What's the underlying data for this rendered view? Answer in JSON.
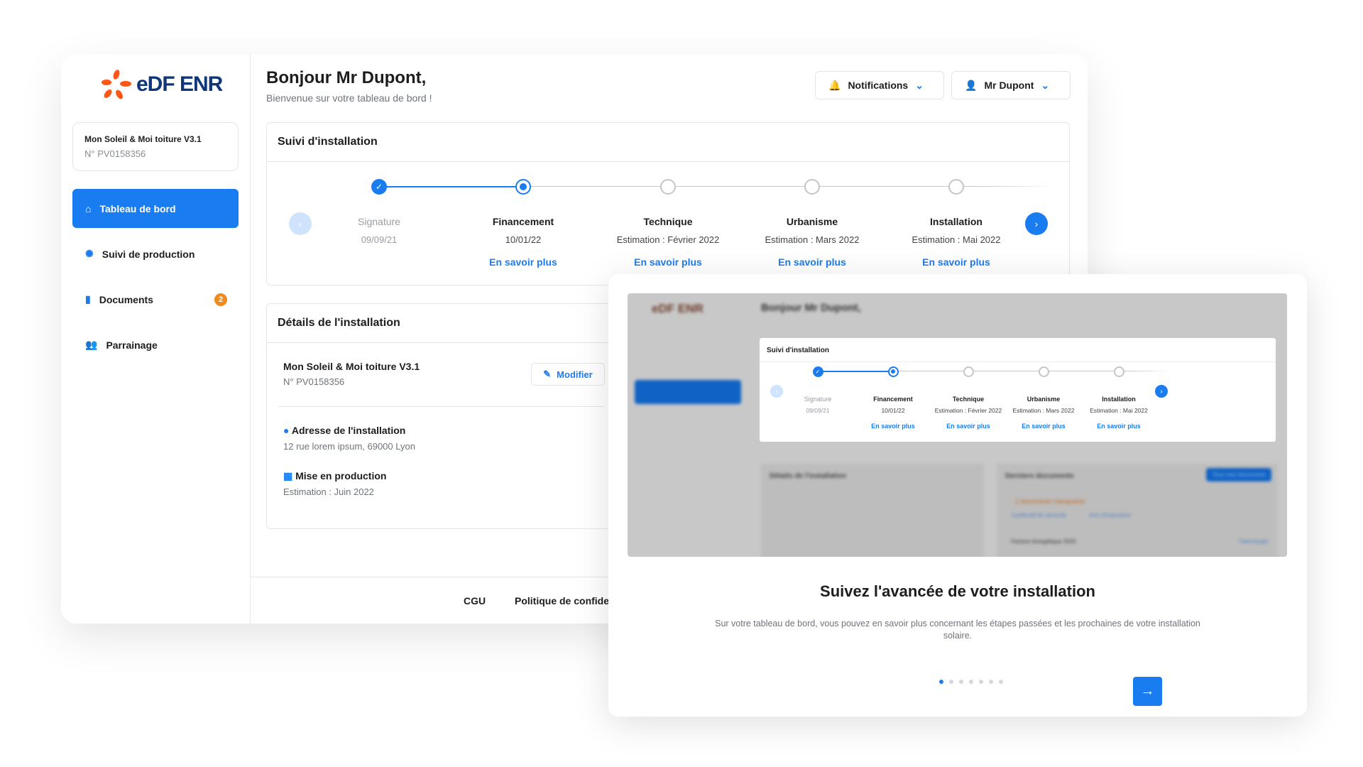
{
  "brand": {
    "name": "eDF ENR",
    "orange": "#fe5716",
    "navy": "#10367a"
  },
  "accent": "#1a7cf1",
  "project": {
    "title": "Mon Soleil & Moi toiture V3.1",
    "number": "N° PV0158356"
  },
  "sidebar": {
    "items": [
      {
        "label": "Tableau de bord",
        "icon": "home-icon",
        "active": true
      },
      {
        "label": "Suivi de production",
        "icon": "sun-icon"
      },
      {
        "label": "Documents",
        "icon": "document-icon",
        "badge": "2"
      },
      {
        "label": "Parrainage",
        "icon": "users-icon"
      }
    ]
  },
  "header": {
    "greeting": "Bonjour Mr Dupont,",
    "subtitle": "Bienvenue sur votre tableau de bord !",
    "notifications": "Notifications",
    "user": "Mr Dupont"
  },
  "tracking": {
    "title": "Suivi d'installation",
    "steps": [
      {
        "label": "Signature",
        "date": "09/09/21",
        "status": "done"
      },
      {
        "label": "Financement",
        "date": "10/01/22",
        "status": "current",
        "link": "En savoir plus"
      },
      {
        "label": "Technique",
        "date": "Estimation : Février 2022",
        "status": "todo",
        "link": "En savoir plus"
      },
      {
        "label": "Urbanisme",
        "date": "Estimation : Mars 2022",
        "status": "todo",
        "link": "En savoir plus"
      },
      {
        "label": "Installation",
        "date": "Estimation : Mai 2022",
        "status": "todo",
        "link": "En savoir plus"
      }
    ]
  },
  "details": {
    "title": "Détails de l'installation",
    "project": "Mon Soleil & Moi toiture V3.1",
    "number": "N° PV0158356",
    "edit": "Modifier",
    "address_label": "Adresse de l'installation",
    "address": "12 rue lorem ipsum, 69000 Lyon",
    "production_label": "Mise en production",
    "production": "Estimation : Juin 2022"
  },
  "documents": {
    "title": "Derniers documents",
    "all": "Tous mes documents",
    "missing": "2 documents manquants",
    "tags": [
      "Justificatif de domicile",
      "Avis d'imposition"
    ],
    "file": "Facture énergétique 2020",
    "download": "Télécharger"
  },
  "footer": {
    "cgu": "CGU",
    "privacy": "Politique de confidentialité"
  },
  "onboarding": {
    "title": "Suivez l'avancée de votre installation",
    "text": "Sur votre tableau de bord, vous pouvez en savoir plus concernant les étapes passées et les prochaines de votre installation solaire.",
    "current_slide": 1,
    "total_slides": 7
  }
}
